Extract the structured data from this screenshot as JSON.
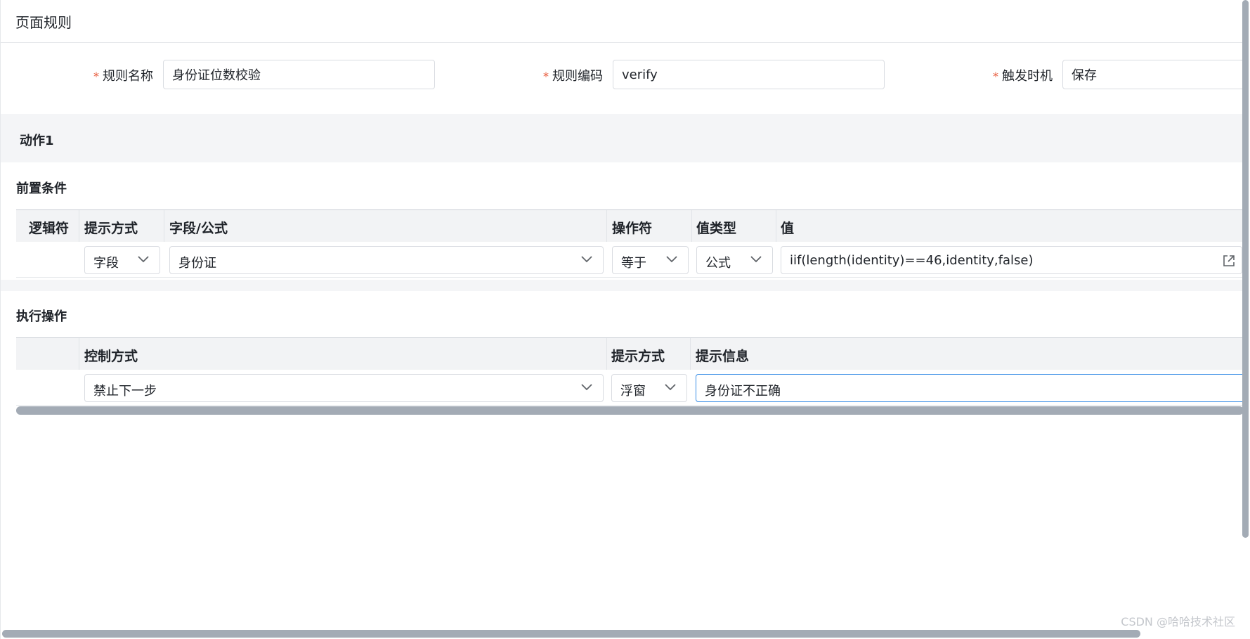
{
  "page": {
    "title": "页面规则"
  },
  "form": {
    "rule_name": {
      "label": "规则名称",
      "required_mark": "*",
      "value": "身份证位数校验"
    },
    "rule_code": {
      "label": "规则编码",
      "required_mark": "*",
      "value": "verify"
    },
    "trigger": {
      "label": "触发时机",
      "required_mark": "*",
      "value": "保存"
    }
  },
  "action": {
    "title": "动作1",
    "precondition": {
      "title": "前置条件",
      "columns": [
        "逻辑符",
        "提示方式",
        "字段/公式",
        "操作符",
        "值类型",
        "值"
      ],
      "row": {
        "hint_mode": "字段",
        "field": "身份证",
        "operator": "等于",
        "value_type": "公式",
        "value": "iif(length(identity)==46,identity,false)"
      }
    },
    "execution": {
      "title": "执行操作",
      "columns": [
        "",
        "控制方式",
        "提示方式",
        "提示信息"
      ],
      "row": {
        "control_mode": "禁止下一步",
        "hint_mode": "浮窗",
        "hint_message": "身份证不正确"
      }
    }
  },
  "watermark": "CSDN @哈哈技术社区",
  "colors": {
    "required": "#e85a3b",
    "focus_border": "#3a8ee6",
    "scrollbar": "#a3abb5"
  }
}
